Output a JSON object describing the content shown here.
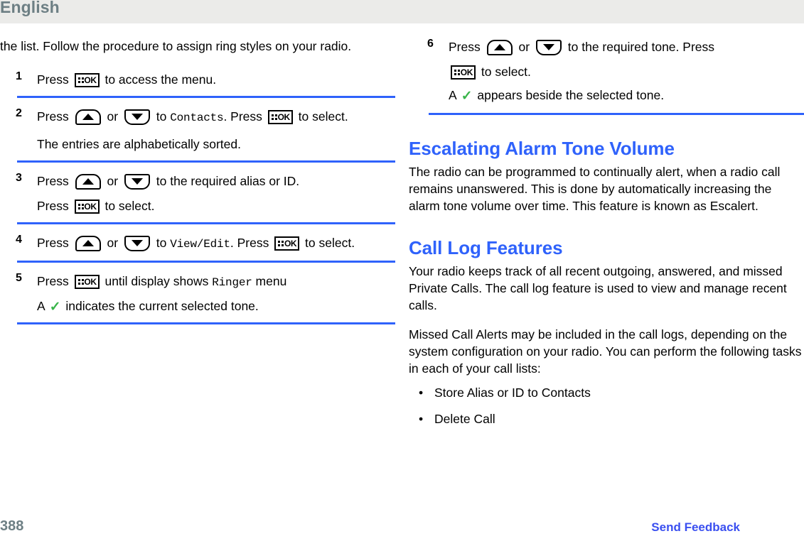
{
  "header": {
    "language": "English"
  },
  "footer": {
    "page_number": "388",
    "feedback_link": "Send Feedback"
  },
  "colors": {
    "heading_blue": "#2f62fb",
    "rule_blue": "#2f62fb",
    "link_blue": "#3a4ff0",
    "header_band": "#ebebe9",
    "header_text": "#6d7f84",
    "check_green": "#39b54a"
  },
  "left_column": {
    "intro": "the list. Follow the procedure to assign ring styles on your radio.",
    "steps": [
      {
        "number": "1",
        "parts": [
          {
            "type": "text",
            "value": "Press "
          },
          {
            "type": "icon",
            "icon": "ok-key-icon",
            "label": "OK"
          },
          {
            "type": "text",
            "value": " to access the menu."
          }
        ]
      },
      {
        "number": "2",
        "parts": [
          {
            "type": "text",
            "value": "Press "
          },
          {
            "type": "icon",
            "icon": "up-arrow-key-icon"
          },
          {
            "type": "text",
            "value": " or "
          },
          {
            "type": "icon",
            "icon": "down-arrow-key-icon"
          },
          {
            "type": "text",
            "value": " to "
          },
          {
            "type": "mono",
            "value": "Contacts"
          },
          {
            "type": "text",
            "value": ". Press "
          },
          {
            "type": "icon",
            "icon": "ok-key-icon",
            "label": "OK"
          },
          {
            "type": "text",
            "value": " to select."
          }
        ],
        "note": "The entries are alphabetically sorted."
      },
      {
        "number": "3",
        "parts": [
          {
            "type": "text",
            "value": "Press "
          },
          {
            "type": "icon",
            "icon": "up-arrow-key-icon"
          },
          {
            "type": "text",
            "value": " or "
          },
          {
            "type": "icon",
            "icon": "down-arrow-key-icon"
          },
          {
            "type": "text",
            "value": " to the required alias or ID."
          }
        ],
        "note_parts": [
          {
            "type": "text",
            "value": "Press "
          },
          {
            "type": "icon",
            "icon": "ok-key-icon",
            "label": "OK"
          },
          {
            "type": "text",
            "value": " to select."
          }
        ]
      },
      {
        "number": "4",
        "parts": [
          {
            "type": "text",
            "value": "Press "
          },
          {
            "type": "icon",
            "icon": "up-arrow-key-icon"
          },
          {
            "type": "text",
            "value": " or "
          },
          {
            "type": "icon",
            "icon": "down-arrow-key-icon"
          },
          {
            "type": "text",
            "value": " to "
          },
          {
            "type": "mono",
            "value": "View/Edit"
          },
          {
            "type": "text",
            "value": ". Press "
          },
          {
            "type": "icon",
            "icon": "ok-key-icon",
            "label": "OK"
          },
          {
            "type": "text",
            "value": " to select."
          }
        ]
      },
      {
        "number": "5",
        "parts": [
          {
            "type": "text",
            "value": "Press "
          },
          {
            "type": "icon",
            "icon": "ok-key-icon",
            "label": "OK"
          },
          {
            "type": "text",
            "value": " until display shows "
          },
          {
            "type": "mono",
            "value": "Ringer"
          },
          {
            "type": "text",
            "value": " menu"
          }
        ],
        "note_parts": [
          {
            "type": "text",
            "value": "A "
          },
          {
            "type": "check",
            "icon": "green-check-icon"
          },
          {
            "type": "text",
            "value": " indicates the current selected tone."
          }
        ]
      }
    ]
  },
  "right_column": {
    "step6": {
      "number": "6",
      "line1_a": "Press ",
      "line1_b": " or ",
      "line1_c": " to the required tone. Press ",
      "line2": " to select.",
      "note_a": "A ",
      "note_b": " appears beside the selected tone."
    },
    "sections": [
      {
        "title": "Escalating Alarm Tone Volume",
        "paragraphs": [
          "The radio can be programmed to continually alert, when a radio call remains unanswered. This is done by automatically increasing the alarm tone volume over time. This feature is known as Escalert."
        ]
      },
      {
        "title": "Call Log Features",
        "paragraphs": [
          "Your radio keeps track of all recent outgoing, answered, and missed Private Calls. The call log feature is used to view and manage recent calls.",
          "Missed Call Alerts may be included in the call logs, depending on the system configuration on your radio. You can perform the following tasks in each of your call lists:"
        ],
        "bullets": [
          "Store Alias or ID to Contacts",
          "Delete Call"
        ],
        "bullet_marker": "•"
      }
    ]
  },
  "icons": {
    "ok_key_label": "OK"
  }
}
